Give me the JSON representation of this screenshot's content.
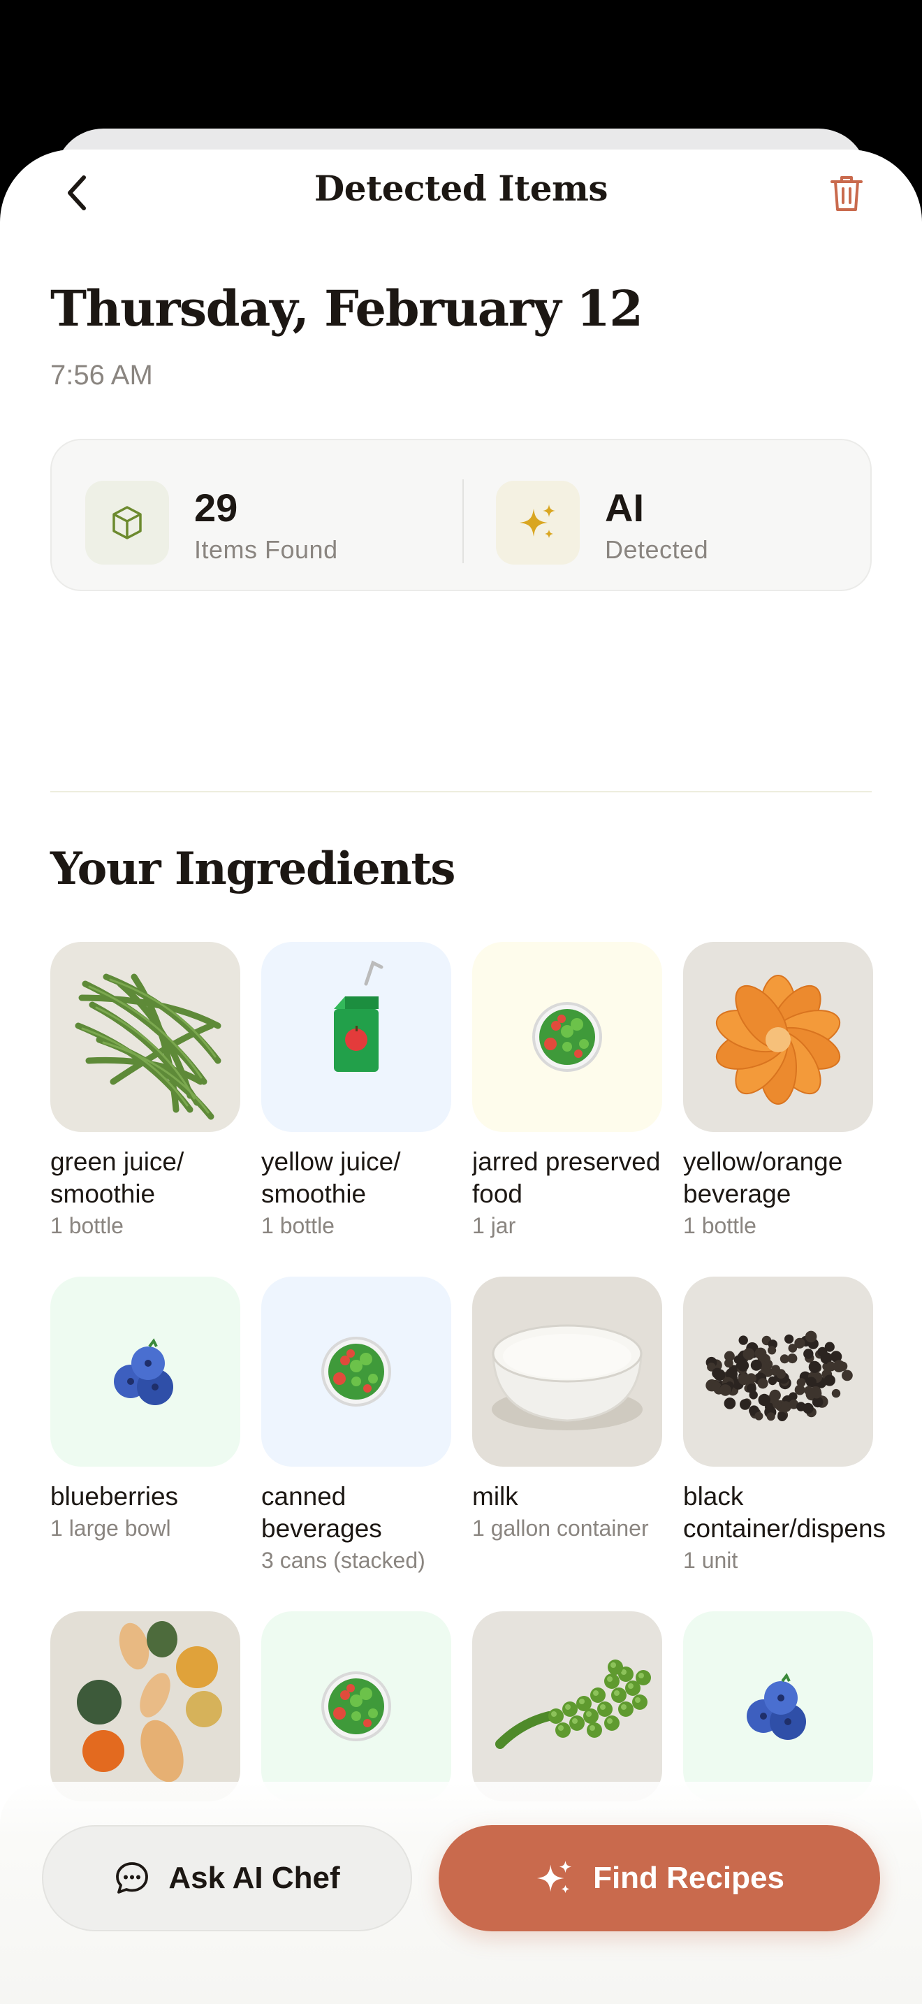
{
  "header": {
    "title": "Detected Items",
    "back_icon": "chevron-left-icon",
    "delete_icon": "trash-icon"
  },
  "scan": {
    "date": "Thursday, February 12",
    "time": "7:56 AM"
  },
  "stats": [
    {
      "value": "29",
      "label": "Items Found",
      "icon": "cube-icon",
      "icon_bg": "#eef0e6",
      "icon_color": "#6c8a2e"
    },
    {
      "value": "AI",
      "label": "Detected",
      "icon": "sparkles-icon",
      "icon_bg": "#f4f1e2",
      "icon_color": "#d9a621"
    }
  ],
  "section_title": "Your Ingredients",
  "items": [
    {
      "name": "green juice/ smoothie",
      "qty": "1 bottle",
      "image": "green-beans",
      "tile_bg": "#e9e6de"
    },
    {
      "name": "yellow juice/ smoothie",
      "qty": "1 bottle",
      "image": "juice-box-emoji",
      "tile_bg": "#eef5fe"
    },
    {
      "name": "jarred preserved food",
      "qty": "1 jar",
      "image": "salad-emoji",
      "tile_bg": "#fefcec"
    },
    {
      "name": "yellow/orange beverage",
      "qty": "1 bottle",
      "image": "tangerine",
      "tile_bg": "#e6e3dd"
    },
    {
      "name": "blueberries",
      "qty": "1 large bowl",
      "image": "blueberries-emoji",
      "tile_bg": "#eefbf1"
    },
    {
      "name": "canned beverages",
      "qty": "3 cans (stacked)",
      "image": "salad-emoji",
      "tile_bg": "#eef5fe"
    },
    {
      "name": "milk",
      "qty": "1 gallon container",
      "image": "milk-bowl",
      "tile_bg": "#e3dfd8"
    },
    {
      "name": "black container/dispenser",
      "qty": "1 unit",
      "image": "peppercorns",
      "tile_bg": "#e6e3dd"
    },
    {
      "name": "",
      "qty": "",
      "image": "squashes",
      "tile_bg": "#e3dfd6"
    },
    {
      "name": "",
      "qty": "",
      "image": "salad-emoji",
      "tile_bg": "#eefbf1"
    },
    {
      "name": "",
      "qty": "",
      "image": "peas",
      "tile_bg": "#e6e3dd"
    },
    {
      "name": "",
      "qty": "",
      "image": "blueberries-emoji",
      "tile_bg": "#eefbf1"
    }
  ],
  "actions": {
    "ask_chef": "Ask AI Chef",
    "find_recipes": "Find Recipes",
    "chat_icon": "chat-bubble-icon",
    "sparkle_icon": "sparkles-icon"
  },
  "colors": {
    "accent": "#c96a4d",
    "text": "#1c1713",
    "muted": "#8a8580"
  }
}
